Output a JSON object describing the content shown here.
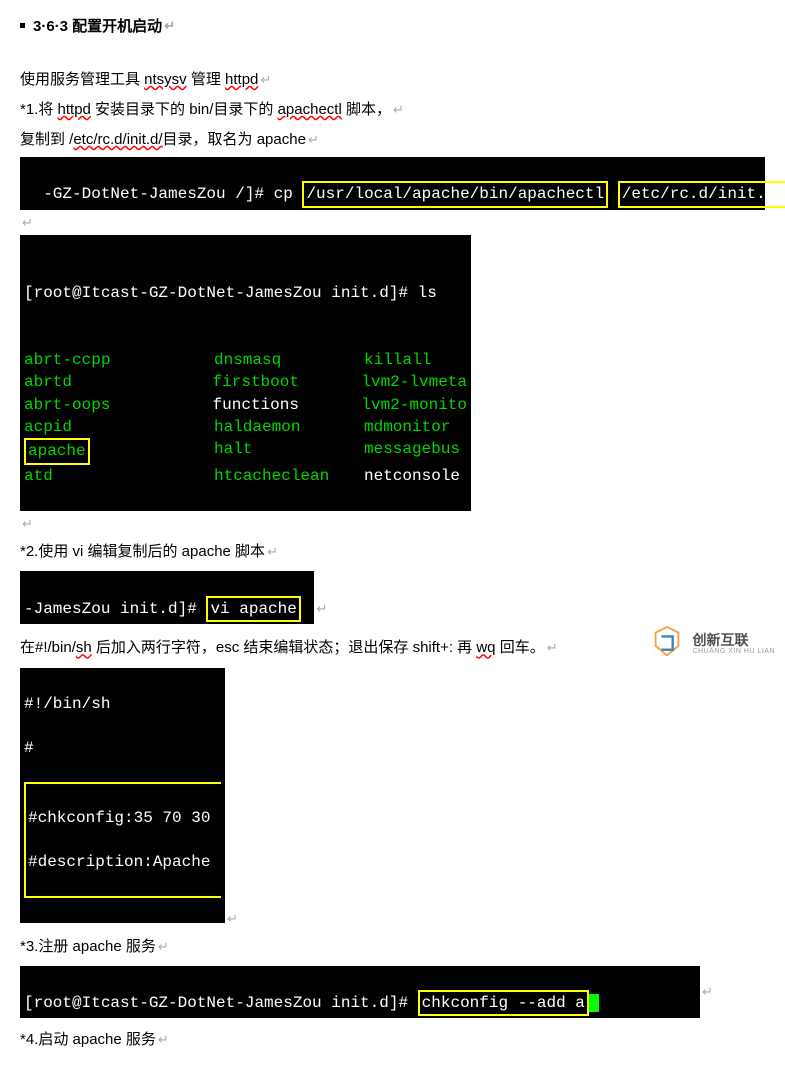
{
  "title": "3·6·3 配置开机启动",
  "intro_line1_a": "使用服务管理工具 ",
  "intro_line1_b": "ntsysv",
  "intro_line1_c": " 管理 ",
  "intro_line1_d": "httpd",
  "step1_a": "*1.将 ",
  "step1_b": "httpd",
  "step1_c": " 安装目录下的 bin/目录下的 ",
  "step1_d": "apachectl",
  "step1_e": "   脚本，",
  "copy_line_a": "复制到  /",
  "copy_line_b": "etc/rc.d/init.d/",
  "copy_line_c": "目录，取名为   apache",
  "cmd1_prompt": "-GZ-DotNet-JamesZou /]# cp ",
  "cmd1_path1": "/usr/local/apache/bin/apachectl",
  "cmd1_path2": "/etc/rc.d/init.d/apache",
  "ls_prompt": "[root@Itcast-GZ-DotNet-JamesZou init.d]# ls",
  "ls_rows": [
    {
      "c1": "abrt-ccpp",
      "c2": "dnsmasq",
      "c3": "killall",
      "c1g": true,
      "c2g": true,
      "c3g": true
    },
    {
      "c1": "abrtd",
      "c2": "firstboot",
      "c3": "lvm2-lvmeta",
      "c1g": true,
      "c2g": true,
      "c3g": true
    },
    {
      "c1": "abrt-oops",
      "c2": "functions",
      "c3": "lvm2-monito",
      "c1g": true,
      "c2g": false,
      "c3g": true
    },
    {
      "c1": "acpid",
      "c2": "haldaemon",
      "c3": "mdmonitor",
      "c1g": true,
      "c2g": true,
      "c3g": true
    },
    {
      "c1": "apache",
      "c2": "halt",
      "c3": "messagebus",
      "c1g": true,
      "c1box": true,
      "c2g": true,
      "c3g": true
    },
    {
      "c1": "atd",
      "c2": "htcacheclean",
      "c3": "netconsole",
      "c1g": true,
      "c2g": true,
      "c3g": false
    }
  ],
  "step2": "*2.使用 vi 编辑复制后的 apache 脚本",
  "cmd2_prompt": "-JamesZou init.d]# ",
  "cmd2_cmd": "vi apache",
  "step2_note_a": "在#!/bin/",
  "step2_note_b": "sh",
  "step2_note_c": "  后加入两行字符，esc 结束编辑状态；退出保存   shift+:     再 ",
  "step2_note_d": "wq",
  "step2_note_e": "  回车。",
  "script_lines": {
    "l1": "#!/bin/sh",
    "l2": "#",
    "l3": "#chkconfig:35 70 30",
    "l4": "#description:Apache"
  },
  "step3": "*3.注册 apache 服务",
  "cmd3_prompt": "[root@Itcast-GZ-DotNet-JamesZou init.d]# ",
  "cmd3_cmd": "chkconfig --add a",
  "step4": "*4.启动 apache 服务",
  "watermark_main": "创新互联",
  "watermark_sub": "CHUANG XIN HU LIAN"
}
